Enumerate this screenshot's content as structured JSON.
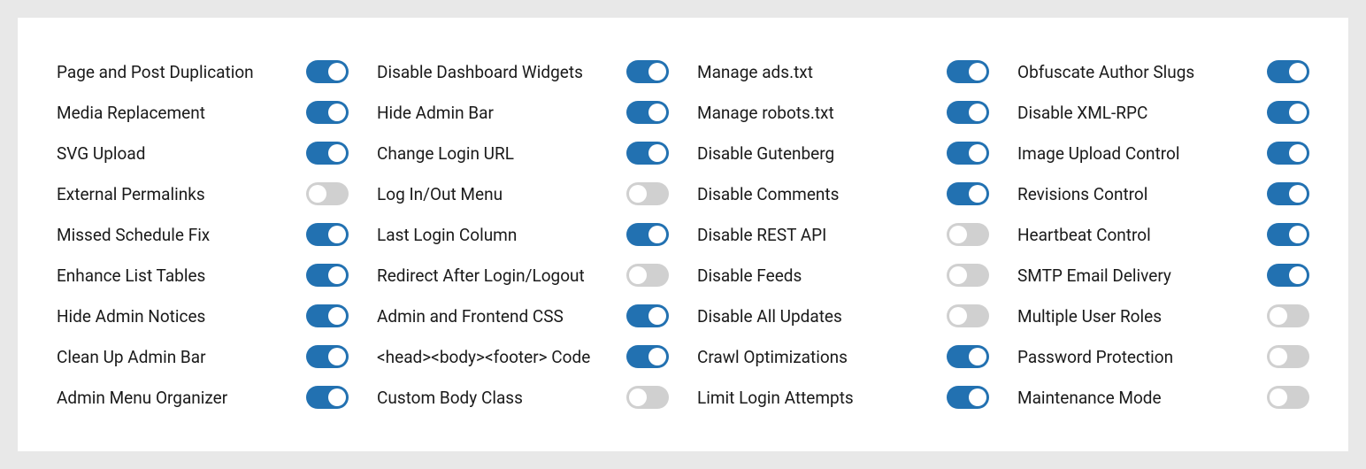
{
  "columns": [
    [
      {
        "label": "Page and Post Duplication",
        "on": true
      },
      {
        "label": "Media Replacement",
        "on": true
      },
      {
        "label": "SVG Upload",
        "on": true
      },
      {
        "label": "External Permalinks",
        "on": false
      },
      {
        "label": "Missed Schedule Fix",
        "on": true
      },
      {
        "label": "Enhance List Tables",
        "on": true
      },
      {
        "label": "Hide Admin Notices",
        "on": true
      },
      {
        "label": "Clean Up Admin Bar",
        "on": true
      },
      {
        "label": "Admin Menu Organizer",
        "on": true
      }
    ],
    [
      {
        "label": "Disable Dashboard Widgets",
        "on": true
      },
      {
        "label": "Hide Admin Bar",
        "on": true
      },
      {
        "label": "Change Login URL",
        "on": true
      },
      {
        "label": "Log In/Out Menu",
        "on": false
      },
      {
        "label": "Last Login Column",
        "on": true
      },
      {
        "label": "Redirect After Login/Logout",
        "on": false
      },
      {
        "label": "Admin and Frontend CSS",
        "on": true
      },
      {
        "label": "<head><body><footer> Code",
        "on": true
      },
      {
        "label": "Custom Body Class",
        "on": false
      }
    ],
    [
      {
        "label": "Manage ads.txt",
        "on": true
      },
      {
        "label": "Manage robots.txt",
        "on": true
      },
      {
        "label": "Disable Gutenberg",
        "on": true
      },
      {
        "label": "Disable Comments",
        "on": true
      },
      {
        "label": "Disable REST API",
        "on": false
      },
      {
        "label": "Disable Feeds",
        "on": false
      },
      {
        "label": "Disable All Updates",
        "on": false
      },
      {
        "label": "Crawl Optimizations",
        "on": true
      },
      {
        "label": "Limit Login Attempts",
        "on": true
      }
    ],
    [
      {
        "label": "Obfuscate Author Slugs",
        "on": true
      },
      {
        "label": "Disable XML-RPC",
        "on": true
      },
      {
        "label": "Image Upload Control",
        "on": true
      },
      {
        "label": "Revisions Control",
        "on": true
      },
      {
        "label": "Heartbeat Control",
        "on": true
      },
      {
        "label": "SMTP Email Delivery",
        "on": true
      },
      {
        "label": "Multiple User Roles",
        "on": false
      },
      {
        "label": "Password Protection",
        "on": false
      },
      {
        "label": "Maintenance Mode",
        "on": false
      }
    ]
  ]
}
